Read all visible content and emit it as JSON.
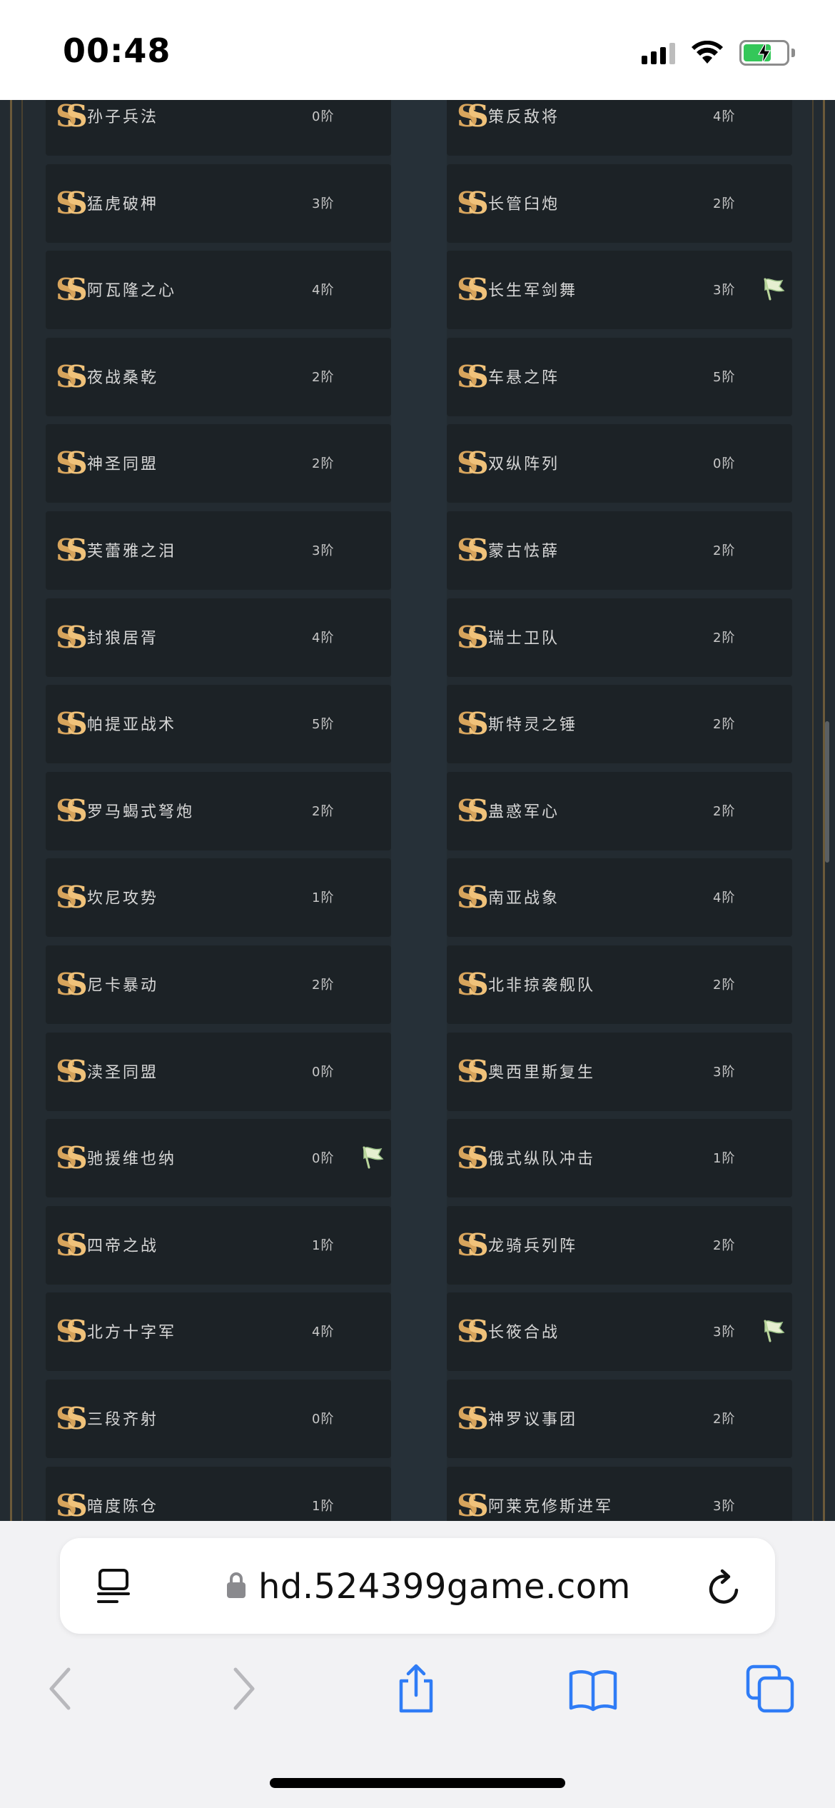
{
  "status_bar": {
    "time": "00:48",
    "battery_state": "charging",
    "battery_color": "#34c759"
  },
  "browser": {
    "url": "hd.524399game.com"
  },
  "icons": {
    "card_logo": "ss-logo-icon",
    "flag": "flag-icon",
    "reader": "reader-mode-icon",
    "lock": "lock-icon",
    "reload": "reload-icon",
    "back": "back-chevron-icon",
    "forward": "forward-chevron-icon",
    "share": "share-icon",
    "bookmarks": "bookmarks-icon",
    "tabs": "tabs-icon"
  },
  "colors": {
    "accent_gold": "#d7a45c",
    "card_bg": "#1c2226",
    "page_bg": "#232b31"
  },
  "left_column": [
    {
      "name": "孙子兵法",
      "level": "0阶",
      "flag": false
    },
    {
      "name": "猛虎破柙",
      "level": "3阶",
      "flag": false
    },
    {
      "name": "阿瓦隆之心",
      "level": "4阶",
      "flag": false
    },
    {
      "name": "夜战桑乾",
      "level": "2阶",
      "flag": false
    },
    {
      "name": "神圣同盟",
      "level": "2阶",
      "flag": false
    },
    {
      "name": "芙蕾雅之泪",
      "level": "3阶",
      "flag": false
    },
    {
      "name": "封狼居胥",
      "level": "4阶",
      "flag": false
    },
    {
      "name": "帕提亚战术",
      "level": "5阶",
      "flag": false
    },
    {
      "name": "罗马蝎式弩炮",
      "level": "2阶",
      "flag": false
    },
    {
      "name": "坎尼攻势",
      "level": "1阶",
      "flag": false
    },
    {
      "name": "尼卡暴动",
      "level": "2阶",
      "flag": false
    },
    {
      "name": "渎圣同盟",
      "level": "0阶",
      "flag": false
    },
    {
      "name": "驰援维也纳",
      "level": "0阶",
      "flag": true
    },
    {
      "name": "四帝之战",
      "level": "1阶",
      "flag": false
    },
    {
      "name": "北方十字军",
      "level": "4阶",
      "flag": false
    },
    {
      "name": "三段齐射",
      "level": "0阶",
      "flag": false
    },
    {
      "name": "暗度陈仓",
      "level": "1阶",
      "flag": false
    }
  ],
  "right_column": [
    {
      "name": "策反敌将",
      "level": "4阶",
      "flag": false
    },
    {
      "name": "长管臼炮",
      "level": "2阶",
      "flag": false
    },
    {
      "name": "长生军剑舞",
      "level": "3阶",
      "flag": true
    },
    {
      "name": "车悬之阵",
      "level": "5阶",
      "flag": false
    },
    {
      "name": "双纵阵列",
      "level": "0阶",
      "flag": false
    },
    {
      "name": "蒙古怯薛",
      "level": "2阶",
      "flag": false
    },
    {
      "name": "瑞士卫队",
      "level": "2阶",
      "flag": false
    },
    {
      "name": "斯特灵之锤",
      "level": "2阶",
      "flag": false
    },
    {
      "name": "蛊惑军心",
      "level": "2阶",
      "flag": false
    },
    {
      "name": "南亚战象",
      "level": "4阶",
      "flag": false
    },
    {
      "name": "北非掠袭舰队",
      "level": "2阶",
      "flag": false
    },
    {
      "name": "奥西里斯复生",
      "level": "3阶",
      "flag": false
    },
    {
      "name": "俄式纵队冲击",
      "level": "1阶",
      "flag": false
    },
    {
      "name": "龙骑兵列阵",
      "level": "2阶",
      "flag": false
    },
    {
      "name": "长筱合战",
      "level": "3阶",
      "flag": true
    },
    {
      "name": "神罗议事团",
      "level": "2阶",
      "flag": false
    },
    {
      "name": "阿莱克修斯进军",
      "level": "3阶",
      "flag": false
    }
  ]
}
